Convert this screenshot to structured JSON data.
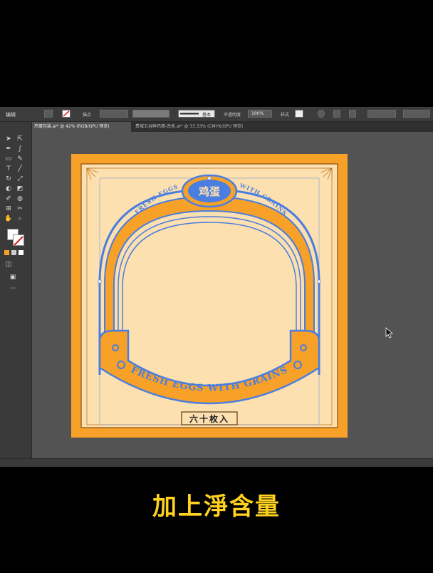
{
  "app": {
    "menu_label": "编辑",
    "control_bar": {
      "point_label": "描点",
      "stroke_style": "基本",
      "opacity_label": "不透明度",
      "opacity_value": "100%",
      "style_label": "样式"
    },
    "tabs": [
      {
        "label": "鸡蛋包装.ai* @ 42% (RGB/GPU 预览)",
        "active": true
      },
      {
        "label": "费城五谷鲜鸡蛋-改色.ai* @ 33.33% (CMYK/GPU 预览)",
        "active": false
      }
    ]
  },
  "artwork": {
    "badge_text": "鸡蛋",
    "arc_text_left": "FRESH EGGS",
    "arc_text_right": "WITH GRAINS",
    "bottom_arc_text": "FRESH EGGS WITH GRAINS",
    "net_content_label": "六十枚入"
  },
  "caption": "加上淨含量",
  "colors": {
    "orange": "#f7a128",
    "cream": "#fde0b0",
    "blue": "#4a7ee0",
    "dark_outline": "#8a4a10",
    "caption_yellow": "#ffd21f"
  }
}
